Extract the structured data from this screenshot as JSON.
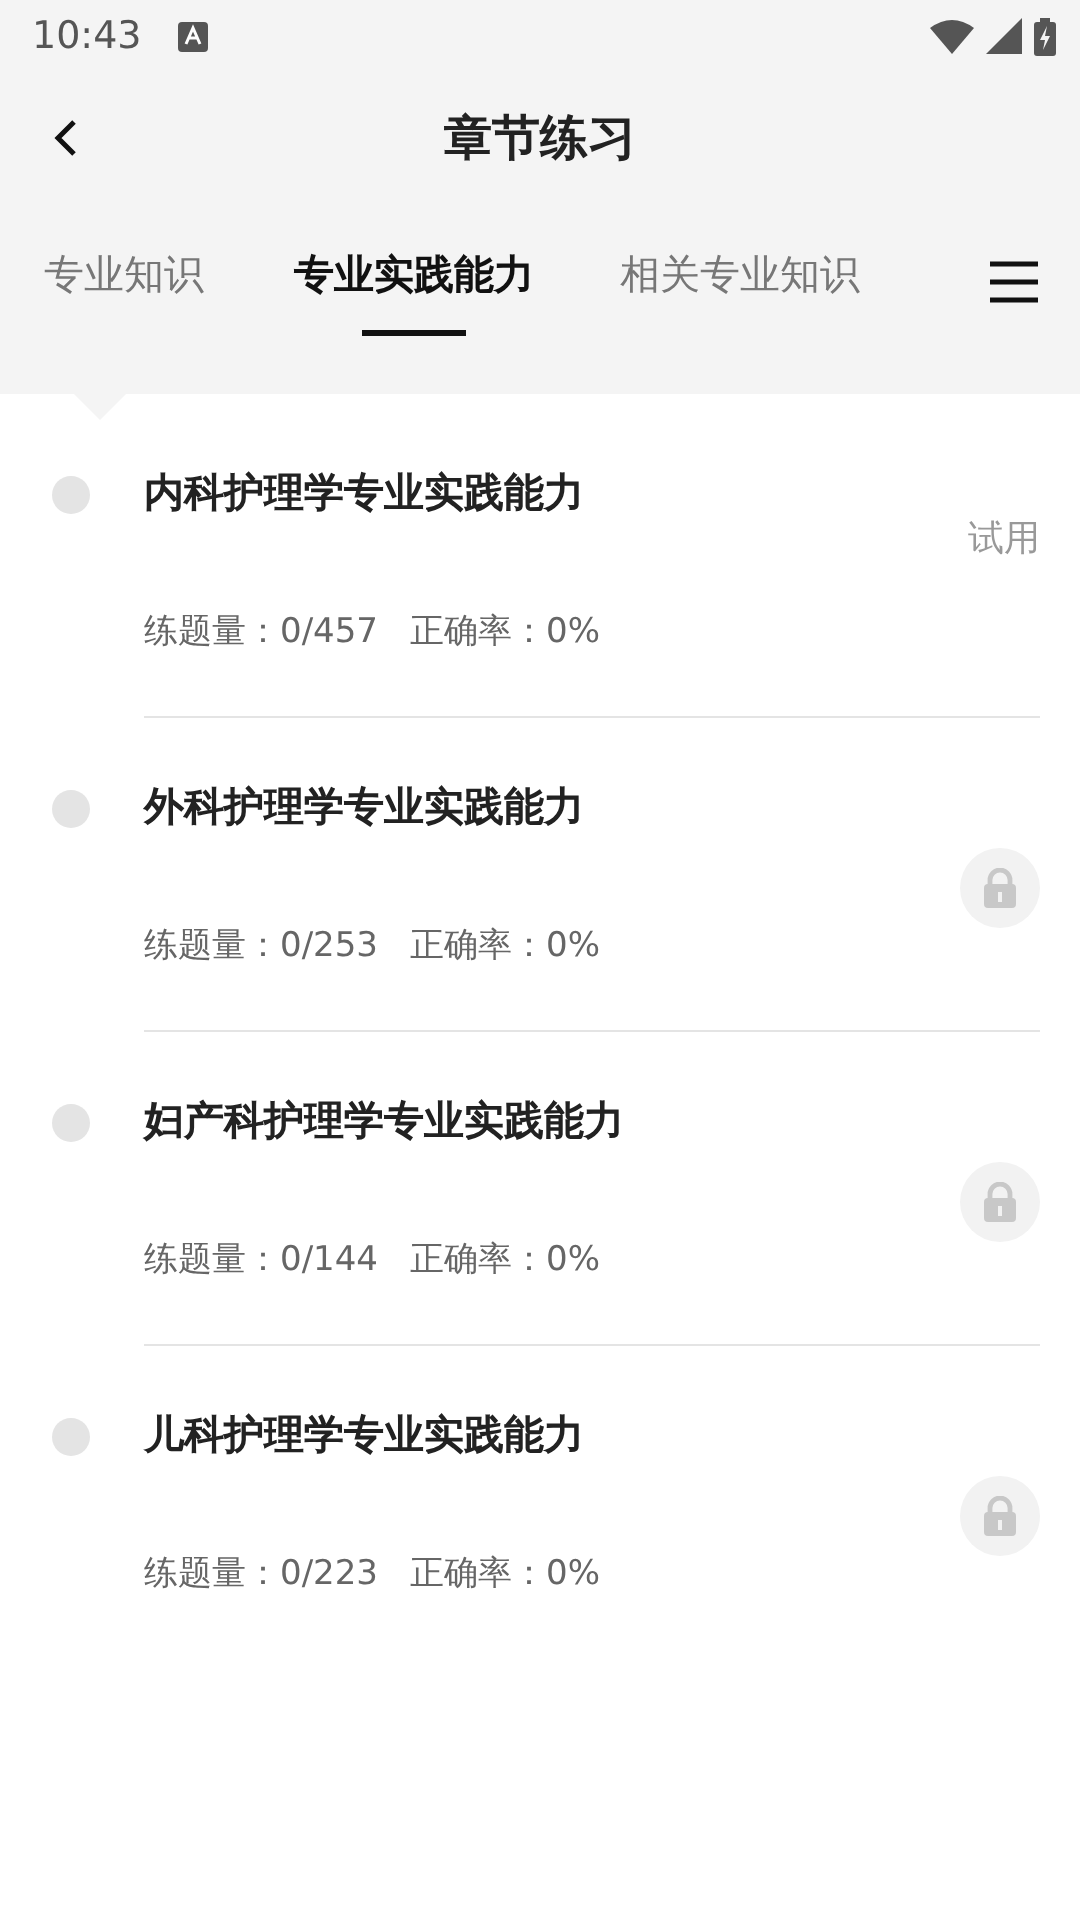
{
  "status_bar": {
    "time": "10:43"
  },
  "header": {
    "title": "章节练习"
  },
  "tabs": [
    {
      "label": "专业知识",
      "selected": false
    },
    {
      "label": "专业实践能力",
      "selected": true
    },
    {
      "label": "相关专业知识",
      "selected": false
    }
  ],
  "chapters": [
    {
      "title": "内科护理学专业实践能力",
      "count": "练题量：0/457",
      "accuracy": "正确率：0%",
      "kind": "trial",
      "badge": "试用"
    },
    {
      "title": "外科护理学专业实践能力",
      "count": "练题量：0/253",
      "accuracy": "正确率：0%",
      "kind": "locked"
    },
    {
      "title": "妇产科护理学专业实践能力",
      "count": "练题量：0/144",
      "accuracy": "正确率：0%",
      "kind": "locked"
    },
    {
      "title": "儿科护理学专业实践能力",
      "count": "练题量：0/223",
      "accuracy": "正确率：0%",
      "kind": "locked"
    }
  ]
}
